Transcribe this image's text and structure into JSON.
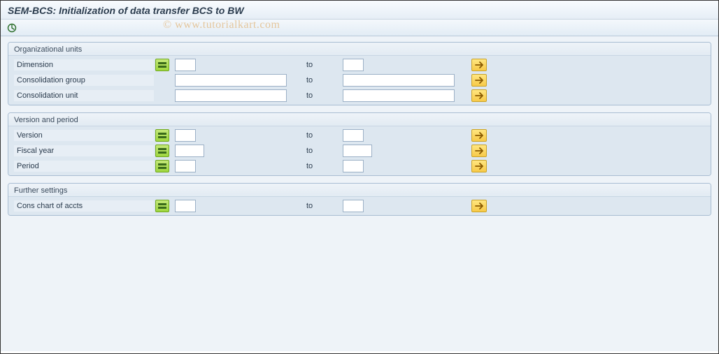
{
  "title": "SEM-BCS: Initialization of data transfer BCS to BW",
  "watermark": "© www.tutorialkart.com",
  "labels": {
    "to": "to"
  },
  "groups": {
    "org": {
      "title": "Organizational units",
      "dimension": {
        "label": "Dimension",
        "from": "",
        "to": ""
      },
      "consgroup": {
        "label": "Consolidation group",
        "from": "",
        "to": ""
      },
      "consunit": {
        "label": "Consolidation unit",
        "from": "",
        "to": ""
      }
    },
    "ver": {
      "title": "Version and period",
      "version": {
        "label": "Version",
        "from": "",
        "to": ""
      },
      "fyear": {
        "label": "Fiscal year",
        "from": "",
        "to": ""
      },
      "period": {
        "label": "Period",
        "from": "",
        "to": ""
      }
    },
    "fs": {
      "title": "Further settings",
      "coa": {
        "label": "Cons chart of accts",
        "from": "",
        "to": ""
      }
    }
  }
}
